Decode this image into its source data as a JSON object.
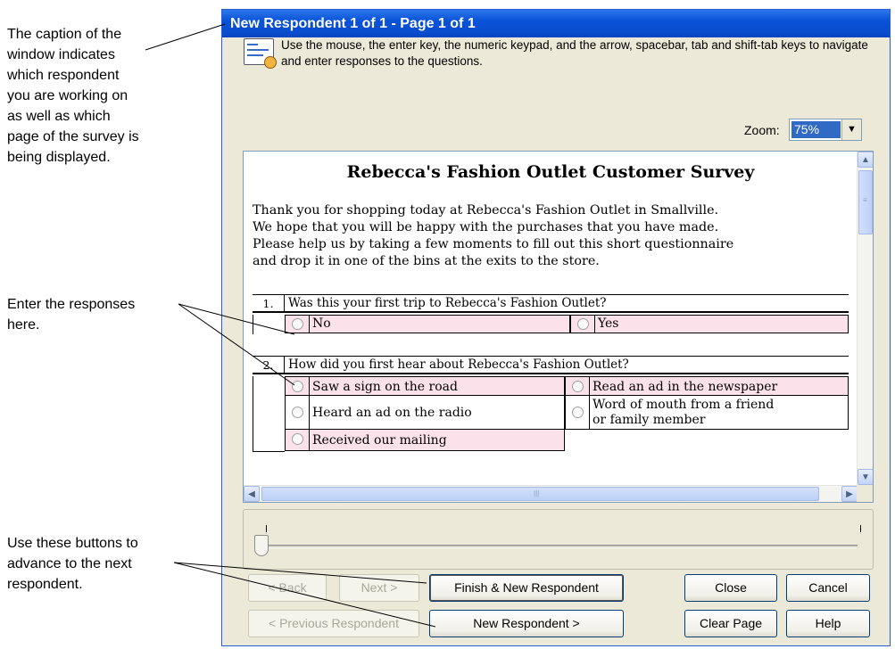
{
  "callouts": {
    "caption": [
      "The caption of the",
      "window indicates",
      "which respondent",
      "you are working on",
      "as well as which",
      "page of the survey is",
      "being displayed."
    ],
    "responses": [
      "Enter the responses",
      "here."
    ],
    "buttons": [
      "Use these buttons to",
      "advance to the next",
      "respondent."
    ]
  },
  "window": {
    "title": "New Respondent 1 of 1 - Page 1 of 1",
    "instructions": "Use the mouse, the enter key, the numeric keypad, and the arrow, spacebar, tab and shift-tab keys to navigate and enter responses to the questions.",
    "zoom_label": "Zoom:",
    "zoom_value": "75%"
  },
  "survey": {
    "title": "Rebecca's Fashion Outlet Customer Survey",
    "intro": [
      "Thank you for shopping today at Rebecca's Fashion Outlet in Smallville.",
      "We hope that you will be happy with the purchases that you have made.",
      "Please help us by taking a few moments to fill out this short questionnaire",
      "and drop it in one of the bins at the exits to the store."
    ],
    "questions": [
      {
        "number": "1.",
        "text": "Was this your first trip to Rebecca's Fashion Outlet?",
        "options": [
          "No",
          "Yes"
        ]
      },
      {
        "number": "2.",
        "text": "How did you first hear about Rebecca's Fashion Outlet?",
        "options": [
          "Saw a sign on the road",
          "Read an ad in the newspaper",
          "Heard an ad on the radio",
          "Word of mouth from a friend",
          "or family member",
          "Received our mailing"
        ]
      }
    ]
  },
  "buttons": {
    "back": "< Back",
    "next": "Next >",
    "finish_new": "Finish & New Respondent",
    "close": "Close",
    "cancel": "Cancel",
    "previous_respondent": "< Previous Respondent",
    "new_respondent": "New Respondent >",
    "clear_page": "Clear Page",
    "help": "Help"
  },
  "colors": {
    "title_bar": "#0a4ccd",
    "response_fill": "#fbe2ea",
    "dialog_face": "#ece9d8"
  },
  "icons": [
    "survey-form-icon",
    "dropdown-arrow-icon",
    "scroll-up-icon",
    "scroll-down-icon",
    "scroll-left-icon",
    "scroll-right-icon",
    "radio-icon"
  ]
}
